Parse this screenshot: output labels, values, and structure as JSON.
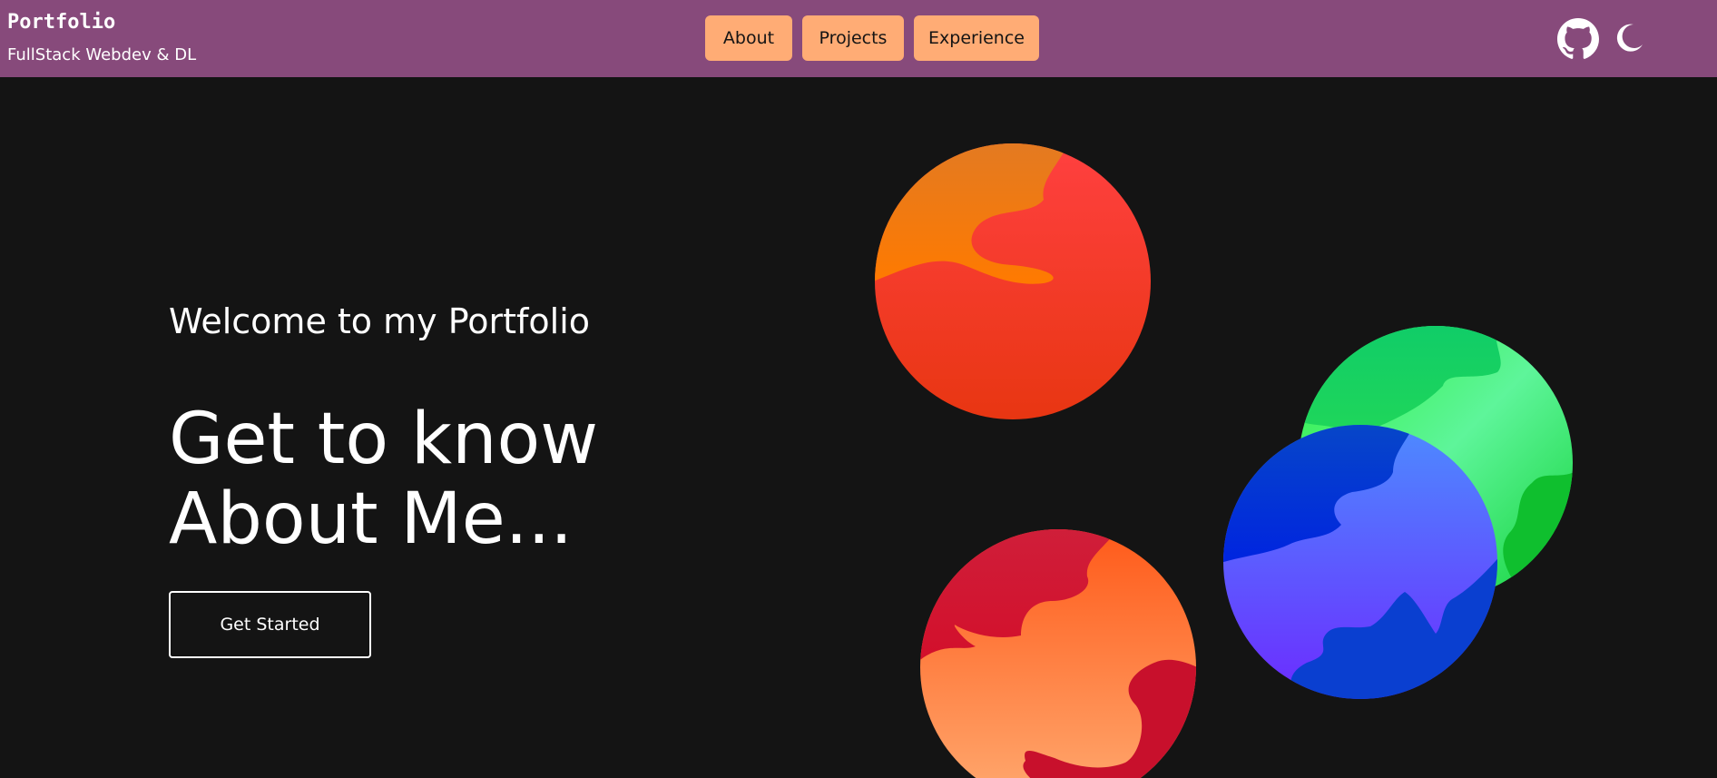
{
  "navbar": {
    "brand_title": "Portfolio",
    "brand_subtitle": "FullStack Webdev & DL",
    "links": [
      {
        "label": "About"
      },
      {
        "label": "Projects"
      },
      {
        "label": "Experience"
      }
    ],
    "icons": [
      "github-icon",
      "moon-icon"
    ]
  },
  "hero": {
    "welcome": "Welcome to my Portfolio",
    "headline": "Get to know About Me...",
    "cta_label": "Get Started"
  },
  "colors": {
    "navbar_bg": "#874a7b",
    "page_bg": "#141414",
    "nav_button_bg": "#ffac75",
    "text_primary": "#ffffff"
  },
  "decorations": [
    "planet-red-orange",
    "planet-green",
    "planet-blue",
    "planet-red-peach"
  ]
}
